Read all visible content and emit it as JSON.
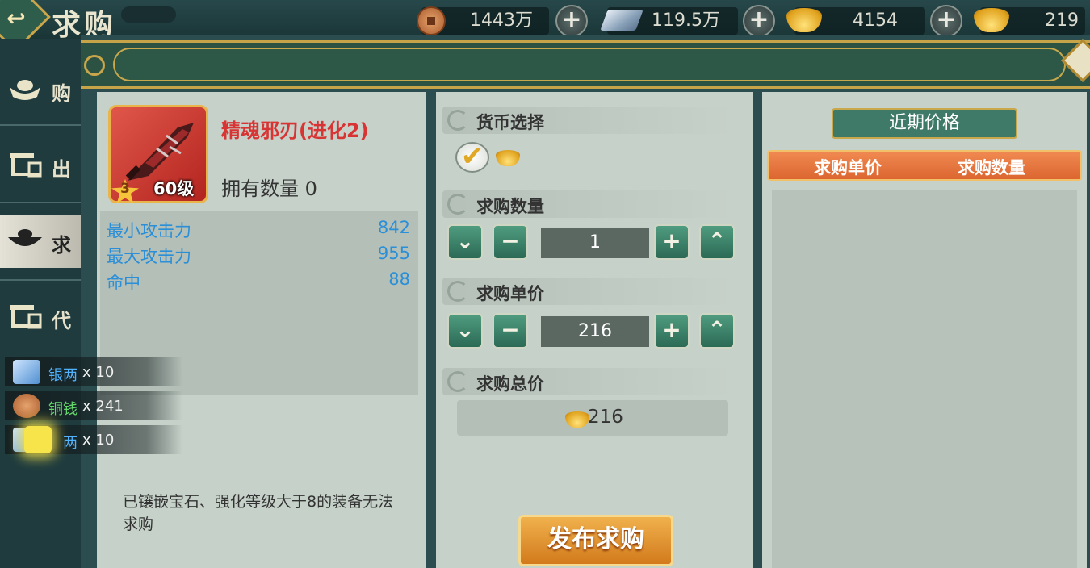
{
  "header": {
    "title": "求购",
    "currencies": [
      {
        "icon": "copper-coin-icon",
        "value": "1443万"
      },
      {
        "icon": "silver-ingot-icon",
        "value": "119.5万"
      },
      {
        "icon": "gold-ingot-icon",
        "value": "4154"
      },
      {
        "icon": "gold-ingot-icon",
        "value": "219"
      }
    ],
    "plus_label": "+"
  },
  "sidebar": {
    "items": [
      {
        "label": "购",
        "icon": "ingot-icon"
      },
      {
        "label": "出",
        "icon": "stall-icon"
      },
      {
        "label": "求",
        "icon": "bowl-ingot-icon",
        "active": true
      },
      {
        "label": "代",
        "icon": "stall-icon"
      }
    ]
  },
  "item": {
    "name": "精魂邪刃(进化2)",
    "star": "3",
    "level": "60级",
    "owned": "拥有数量 0",
    "stats": [
      {
        "label": "最小攻击力",
        "value": "842"
      },
      {
        "label": "最大攻击力",
        "value": "955"
      },
      {
        "label": "命中",
        "value": "88"
      }
    ],
    "notice": "已镶嵌宝石、强化等级大于8的装备无法求购"
  },
  "form": {
    "currency_label": "货币选择",
    "quantity_label": "求购数量",
    "quantity_value": "1",
    "price_label": "求购单价",
    "price_value": "216",
    "total_label": "求购总价",
    "total_value": "216",
    "publish_label": "发布求购",
    "min_symbol": "⌄",
    "minus_symbol": "−",
    "plus_symbol": "+",
    "max_symbol": "⌃"
  },
  "recent": {
    "tab_label": "近期价格",
    "col_price": "求购单价",
    "col_qty": "求购数量"
  },
  "rewards": [
    {
      "name": "银两",
      "qty": "x 10",
      "color": "#4fb3ff"
    },
    {
      "name": "铜钱",
      "qty": "x 241",
      "color": "#63d86b"
    },
    {
      "name": "两",
      "qty": "x 10",
      "color": "#4fb3ff"
    }
  ],
  "colors": {
    "accent_gold": "#c9a64a",
    "item_name": "#d83434",
    "stat_blue": "#2b8fd8",
    "publish_orange": "#e08e2c"
  }
}
